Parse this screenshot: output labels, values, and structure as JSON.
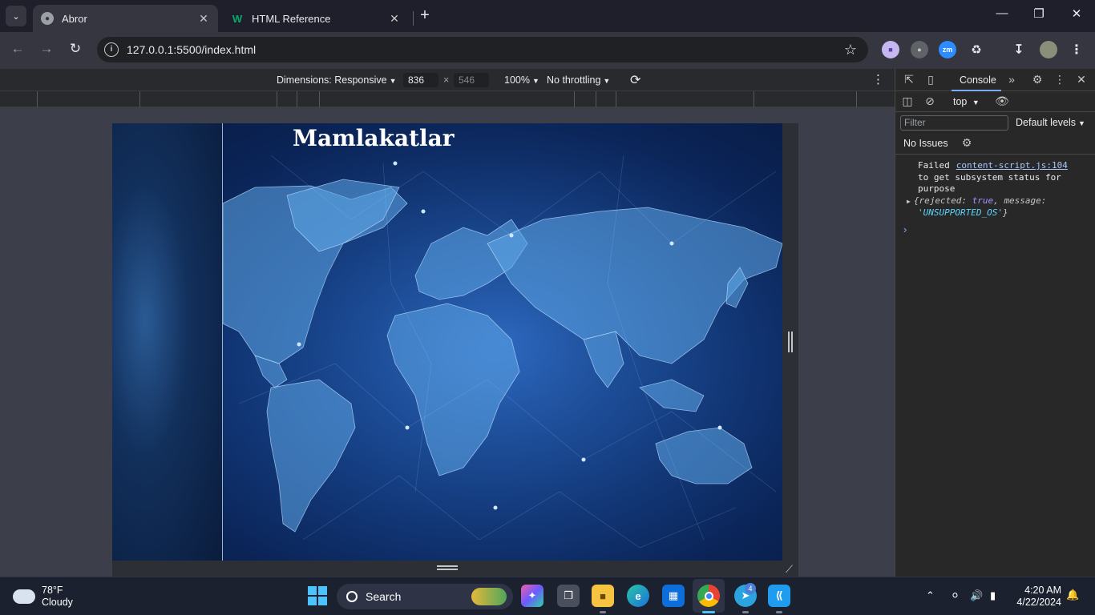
{
  "browser": {
    "tabs": [
      {
        "title": "Abror",
        "active": true
      },
      {
        "title": "HTML Reference",
        "active": false
      }
    ],
    "url": "127.0.0.1:5500/index.html"
  },
  "device_toolbar": {
    "dimensions_label": "Dimensions: Responsive",
    "width": "836",
    "height": "546",
    "zoom": "100%",
    "throttling": "No throttling"
  },
  "page": {
    "heading": "Mamlakatlar"
  },
  "devtools": {
    "active_tab": "Console",
    "context": "top",
    "filter_placeholder": "Filter",
    "levels": "Default levels",
    "issues": "No Issues",
    "message": {
      "text_1": "Failed",
      "source": "content-script.js:104",
      "text_2": "to get subsystem status for purpose",
      "obj_open": "{",
      "key1": "rejected",
      "val1": "true",
      "key2": "message",
      "val2": "'UNSUPPORTED_OS'",
      "obj_close": "}"
    }
  },
  "taskbar": {
    "weather_temp": "78°F",
    "weather_desc": "Cloudy",
    "search_label": "Search",
    "time": "4:20 AM",
    "date": "4/22/2024",
    "telegram_badge": "4"
  }
}
